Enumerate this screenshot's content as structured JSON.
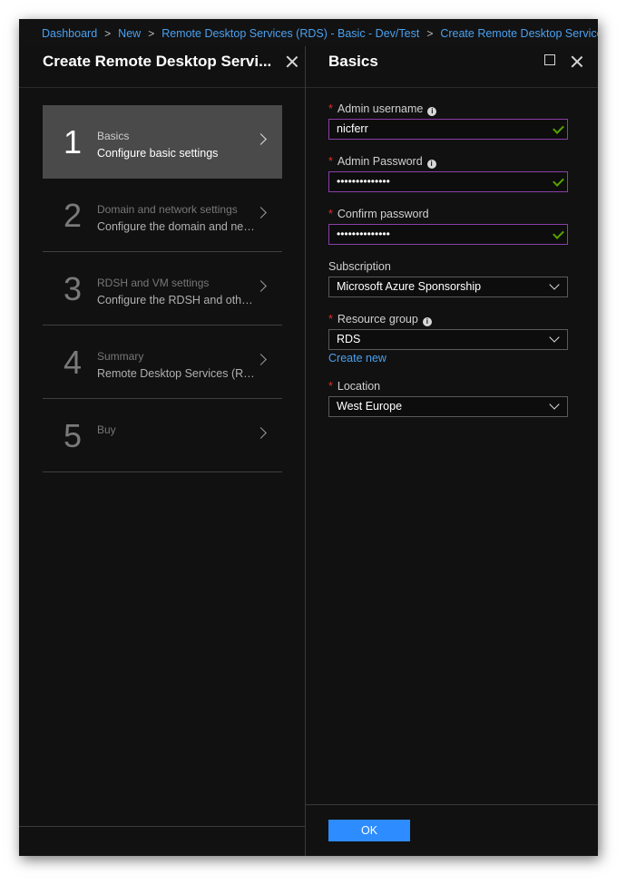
{
  "breadcrumb": {
    "items": [
      "Dashboard",
      "New",
      "Remote Desktop Services (RDS) - Basic - Dev/Test",
      "Create Remote Desktop Services"
    ],
    "separator": ">"
  },
  "left_blade": {
    "title": "Create Remote Desktop Servi...",
    "steps": [
      {
        "number": "1",
        "title": "Basics",
        "subtitle": "Configure basic settings",
        "active": true
      },
      {
        "number": "2",
        "title": "Domain and network settings",
        "subtitle": "Configure the domain and net...",
        "active": false
      },
      {
        "number": "3",
        "title": "RDSH and VM settings",
        "subtitle": "Configure the RDSH and other ...",
        "active": false
      },
      {
        "number": "4",
        "title": "Summary",
        "subtitle": "Remote Desktop Services (RDS...",
        "active": false
      },
      {
        "number": "5",
        "title": "Buy",
        "subtitle": "",
        "active": false
      }
    ]
  },
  "right_blade": {
    "title": "Basics",
    "fields": {
      "admin_username": {
        "label": "Admin username",
        "value": "nicferr",
        "required": true
      },
      "admin_password": {
        "label": "Admin Password",
        "value": "••••••••••••••",
        "required": true
      },
      "confirm_password": {
        "label": "Confirm password",
        "value": "••••••••••••••",
        "required": true
      },
      "subscription": {
        "label": "Subscription",
        "value": "Microsoft Azure Sponsorship"
      },
      "resource_group": {
        "label": "Resource group",
        "value": "RDS",
        "required": true,
        "link": "Create new"
      },
      "location": {
        "label": "Location",
        "value": "West Europe",
        "required": true
      }
    },
    "ok_label": "OK"
  },
  "icons": {
    "required_marker": "*",
    "info": "i"
  },
  "colors": {
    "accent_link": "#4aa0ef",
    "ok_button": "#2d8cff",
    "valid_check": "#57a300",
    "required": "#e0302a",
    "active_input_border": "#8a3ea8"
  }
}
